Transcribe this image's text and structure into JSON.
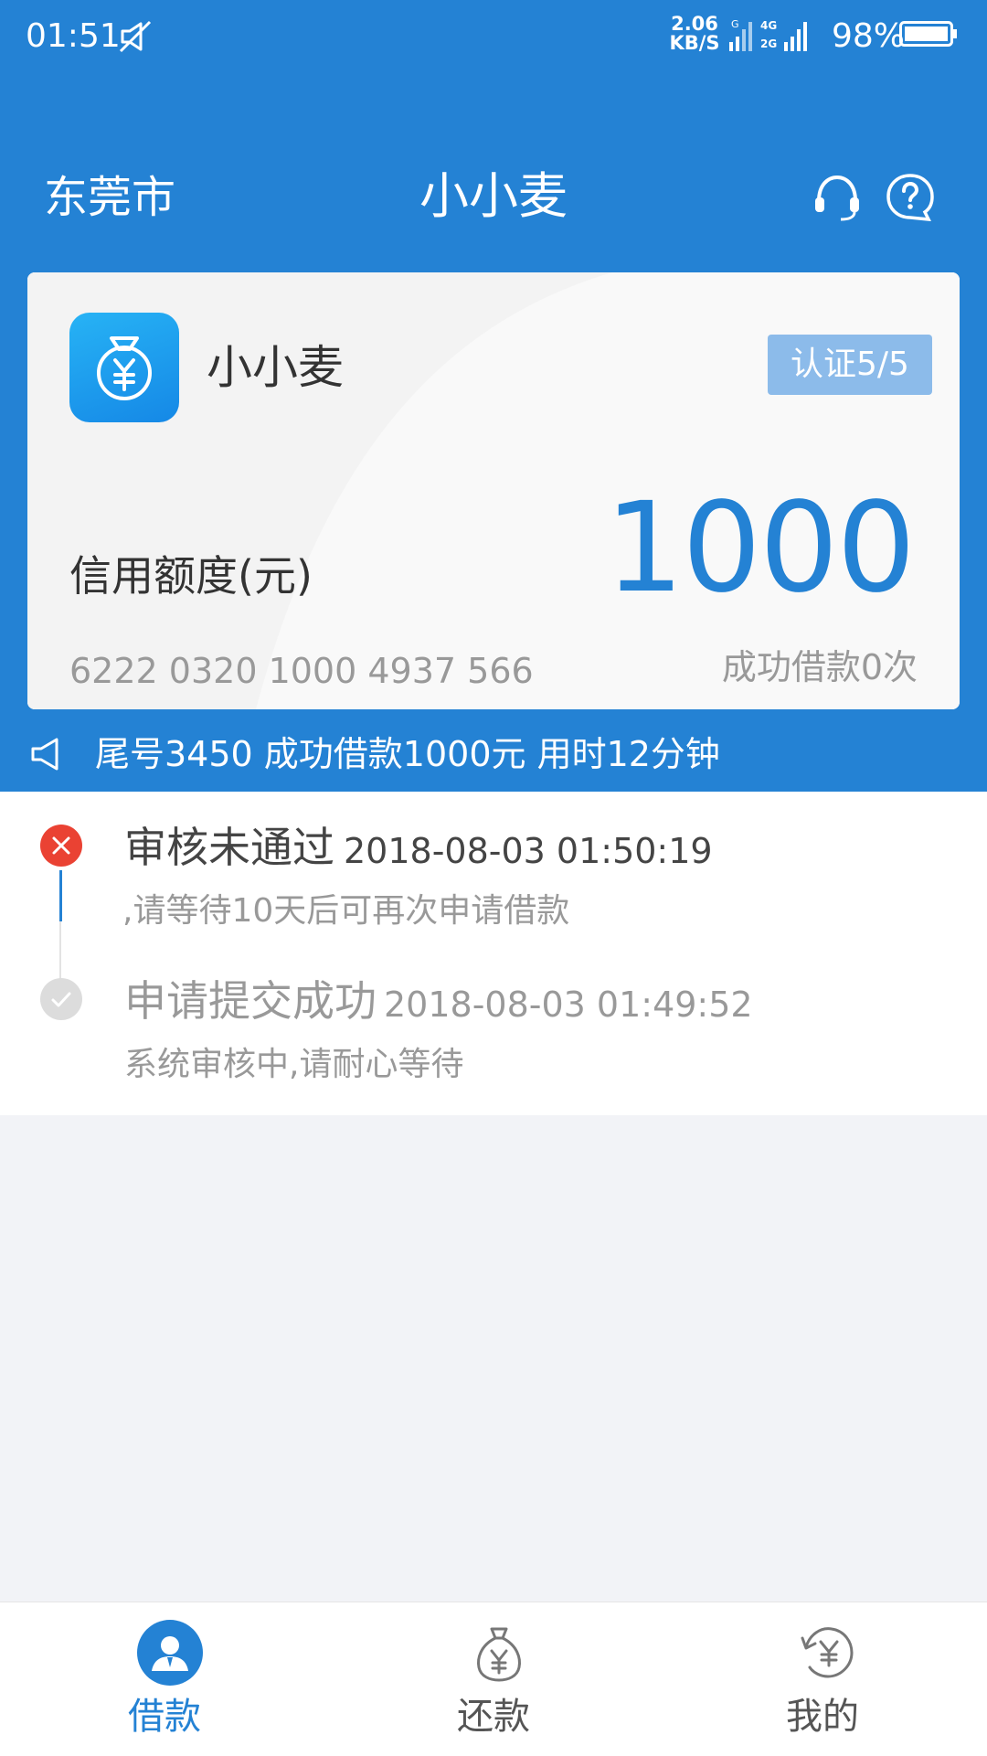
{
  "status_bar": {
    "time": "01:51",
    "net_speed_value": "2.06",
    "net_speed_unit": "KB/S",
    "battery_percent": "98%",
    "icons": [
      "mute-icon",
      "signal-icon",
      "battery-icon"
    ]
  },
  "nav": {
    "city": "东莞市",
    "title": "小小麦",
    "icons": [
      "headset-icon",
      "help-icon"
    ]
  },
  "card": {
    "app_name": "小小麦",
    "certification_label": "认证5/5",
    "credit_limit_label": "信用额度(元)",
    "credit_limit_amount": "1000",
    "card_number": "6222 0320 1000 4937 566",
    "success_loans": "成功借款0次"
  },
  "notice": {
    "text": "尾号3450 成功借款1000元 用时12分钟"
  },
  "timeline": [
    {
      "status": "审核未通过",
      "time": "2018-08-03 01:50:19",
      "note": ",请等待10天后可再次申请借款",
      "state": "failed"
    },
    {
      "status": "申请提交成功",
      "time": "2018-08-03 01:49:52",
      "note": "系统审核中,请耐心等待",
      "state": "done"
    }
  ],
  "tabs": [
    {
      "label": "借款",
      "icon": "borrow-user-icon",
      "active": true
    },
    {
      "label": "还款",
      "icon": "money-bag-icon",
      "active": false
    },
    {
      "label": "我的",
      "icon": "refresh-yuan-icon",
      "active": false
    }
  ],
  "colors": {
    "primary": "#2482d4",
    "error": "#ea4233",
    "background": "#f2f3f7"
  }
}
